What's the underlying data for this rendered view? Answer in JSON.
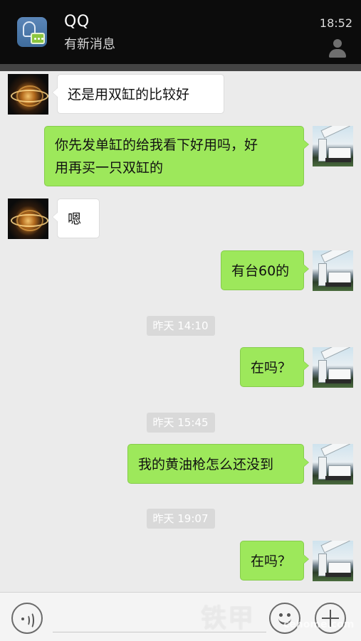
{
  "notification": {
    "app_name": "QQ",
    "subtitle": "有新消息",
    "time": "18:52"
  },
  "messages": [
    {
      "side": "in",
      "text": "还是用双缸的比较好"
    },
    {
      "side": "out",
      "line1": "你先发单缸的给我看下好用吗，好",
      "line2": "用再买一只双缸的"
    },
    {
      "side": "in",
      "text": "嗯"
    },
    {
      "side": "out",
      "text": "有台60的"
    },
    {
      "side": "out",
      "text": "在吗？"
    },
    {
      "side": "out",
      "text": "我的黄油枪怎么还没到"
    },
    {
      "side": "out",
      "text": "在吗？"
    }
  ],
  "timestamps": [
    "昨天 14:10",
    "昨天 15:45",
    "昨天 19:07"
  ],
  "input_bar": {
    "voice_icon": "voice-icon",
    "emoji_icon": "emoji-icon",
    "plus_icon": "plus-icon"
  },
  "watermark": {
    "text": "铁甲",
    "sub": "cehome.com"
  },
  "colors": {
    "out_bubble": "#9de85b",
    "in_bubble": "#ffffff",
    "chat_background": "#ebebeb",
    "notification_background": "#0c0c0c"
  }
}
